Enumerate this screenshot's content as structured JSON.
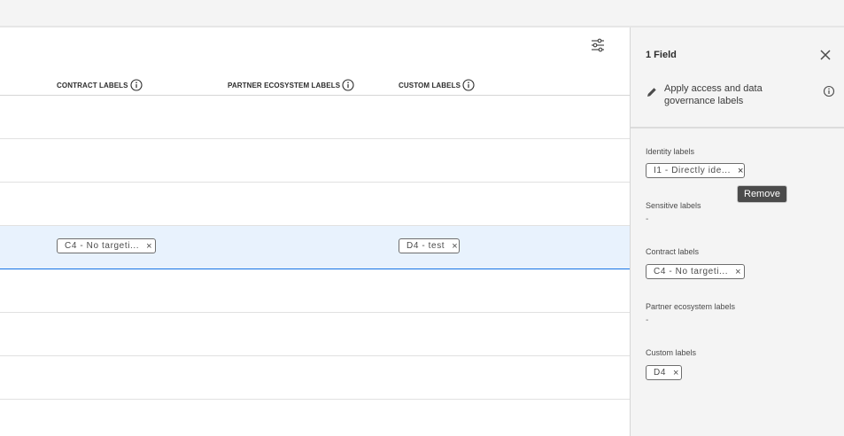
{
  "table": {
    "columns": [
      {
        "label": "CONTRACT LABELS"
      },
      {
        "label": "PARTNER ECOSYSTEM LABELS"
      },
      {
        "label": "CUSTOM LABELS"
      }
    ],
    "selected_row": {
      "contract_tag": "C4 - No targeti...",
      "custom_tag": "D4 - test"
    },
    "row_count": 7
  },
  "panel": {
    "title": "1 Field",
    "apply_text": "Apply access and data governance labels",
    "sections": {
      "identity": {
        "label": "Identity labels",
        "tag": "I1 - Directly ide..."
      },
      "sensitive": {
        "label": "Sensitive labels",
        "empty": "-"
      },
      "contract": {
        "label": "Contract labels",
        "tag": "C4 - No targeti..."
      },
      "partner": {
        "label": "Partner ecosystem labels",
        "empty": "-"
      },
      "custom": {
        "label": "Custom labels",
        "tag": "D4"
      }
    }
  },
  "tooltip": {
    "text": "Remove"
  },
  "icons": {
    "filter": "filter-settings-icon",
    "info": "info-icon",
    "close": "close-icon",
    "edit": "pencil-icon",
    "remove": "remove-x-icon"
  },
  "colors": {
    "selected_row_bg": "#e8f2fd",
    "selected_row_border": "#1473e6",
    "tooltip_bg": "#4b4b4b"
  }
}
